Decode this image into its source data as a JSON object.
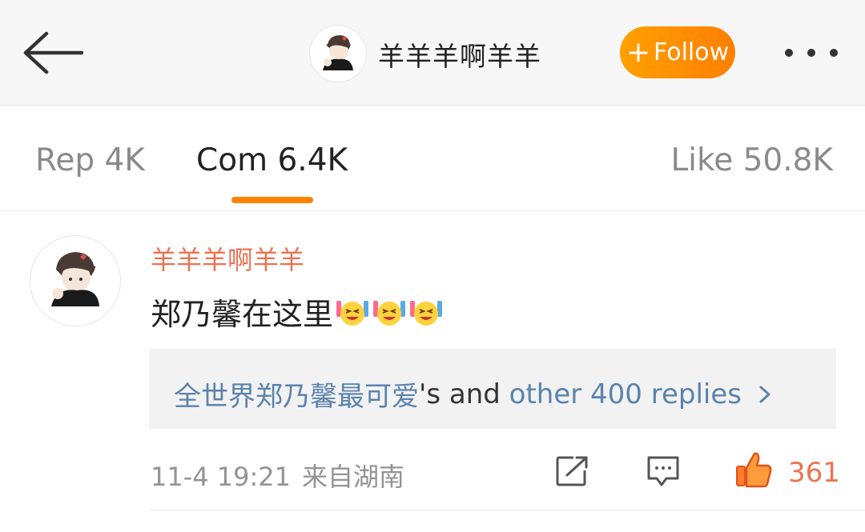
{
  "header": {
    "back_icon": "arrow-left-icon",
    "username": "羊羊羊啊羊羊",
    "follow": {
      "plus": "+",
      "label": "Follow"
    },
    "more_icon": "more-dots-icon"
  },
  "tabs": [
    {
      "label": "Rep 4K",
      "active": false
    },
    {
      "label": "Com 6.4K",
      "active": true
    },
    {
      "label": "Like 50.8K",
      "active": false
    }
  ],
  "comment": {
    "username": "羊羊羊啊羊羊",
    "text": "郑乃馨在这里",
    "emoji": [
      "laughing-cheer-emoji",
      "laughing-cheer-emoji",
      "laughing-cheer-emoji"
    ],
    "replies": {
      "name": "全世界郑乃馨最可爱",
      "possessive": "'s and ",
      "other": "other 400 replies"
    },
    "time": "11-4 19:21",
    "source": "来自湖南",
    "likes": "361"
  },
  "colors": {
    "accent": "#ff8200",
    "username": "#eb7350",
    "link": "#5b83ad",
    "muted": "#939393"
  }
}
